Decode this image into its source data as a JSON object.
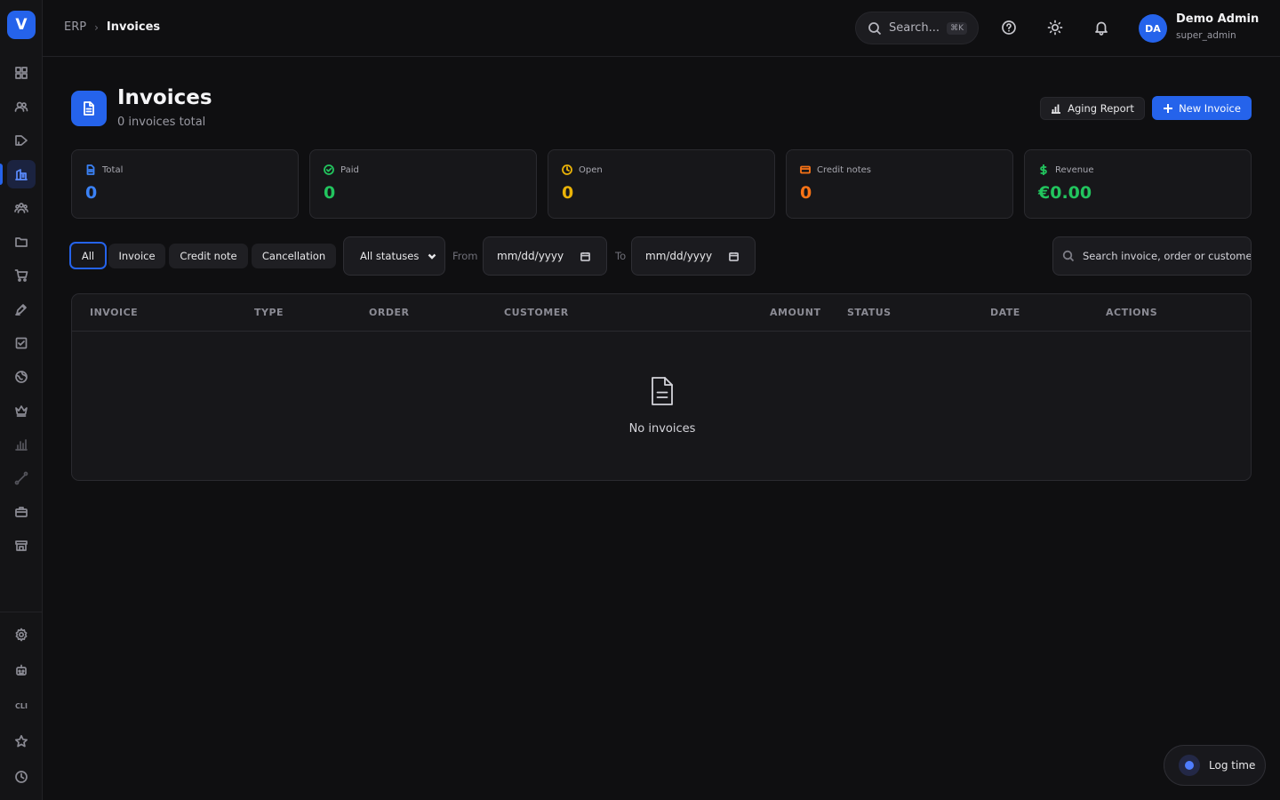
{
  "app": {
    "logo_letter": "V"
  },
  "sidebar": {
    "items": [
      {
        "name": "dashboard-icon"
      },
      {
        "name": "contacts-icon"
      },
      {
        "name": "marketing-icon"
      },
      {
        "name": "erp-icon",
        "active": true
      },
      {
        "name": "team-icon"
      },
      {
        "name": "folder-icon"
      },
      {
        "name": "cart-icon"
      },
      {
        "name": "pen-icon"
      },
      {
        "name": "tasks-icon"
      },
      {
        "name": "globe-icon"
      },
      {
        "name": "crown-icon"
      },
      {
        "name": "chart-icon"
      },
      {
        "name": "route-icon"
      },
      {
        "name": "briefcase-icon"
      },
      {
        "name": "store-icon"
      }
    ],
    "bottom": {
      "cli_label": "CLI"
    }
  },
  "breadcrumb": {
    "root": "ERP",
    "current": "Invoices"
  },
  "topbar": {
    "search_placeholder": "Search...",
    "search_shortcut": "⌘K",
    "user": {
      "initials": "DA",
      "name": "Demo Admin",
      "role": "super_admin"
    }
  },
  "header": {
    "title": "Invoices",
    "subtitle": "0 invoices total",
    "aging_report_label": "Aging Report",
    "new_invoice_label": "New Invoice"
  },
  "stats": [
    {
      "label": "Total",
      "value": "0",
      "color": "#3b82f6"
    },
    {
      "label": "Paid",
      "value": "0",
      "color": "#22c55e"
    },
    {
      "label": "Open",
      "value": "0",
      "color": "#eab308"
    },
    {
      "label": "Credit notes",
      "value": "0",
      "color": "#f97316"
    },
    {
      "label": "Revenue",
      "value": "€0.00",
      "color": "#22c55e"
    }
  ],
  "filters": {
    "type_tabs": [
      "All",
      "Invoice",
      "Credit note",
      "Cancellation"
    ],
    "active_tab": "All",
    "status_selected": "All statuses",
    "from_label": "From",
    "to_label": "To",
    "from_placeholder": "mm/dd/yyyy",
    "to_placeholder": "mm/dd/yyyy",
    "search_placeholder": "Search invoice, order or customer..."
  },
  "table": {
    "columns": [
      "INVOICE",
      "TYPE",
      "ORDER",
      "CUSTOMER",
      "AMOUNT",
      "STATUS",
      "DATE",
      "ACTIONS"
    ],
    "empty_text": "No invoices"
  },
  "log_time": {
    "label": "Log time"
  },
  "colors": {
    "accent": "#2563eb",
    "background": "#0f0f11",
    "card": "#17171a"
  }
}
